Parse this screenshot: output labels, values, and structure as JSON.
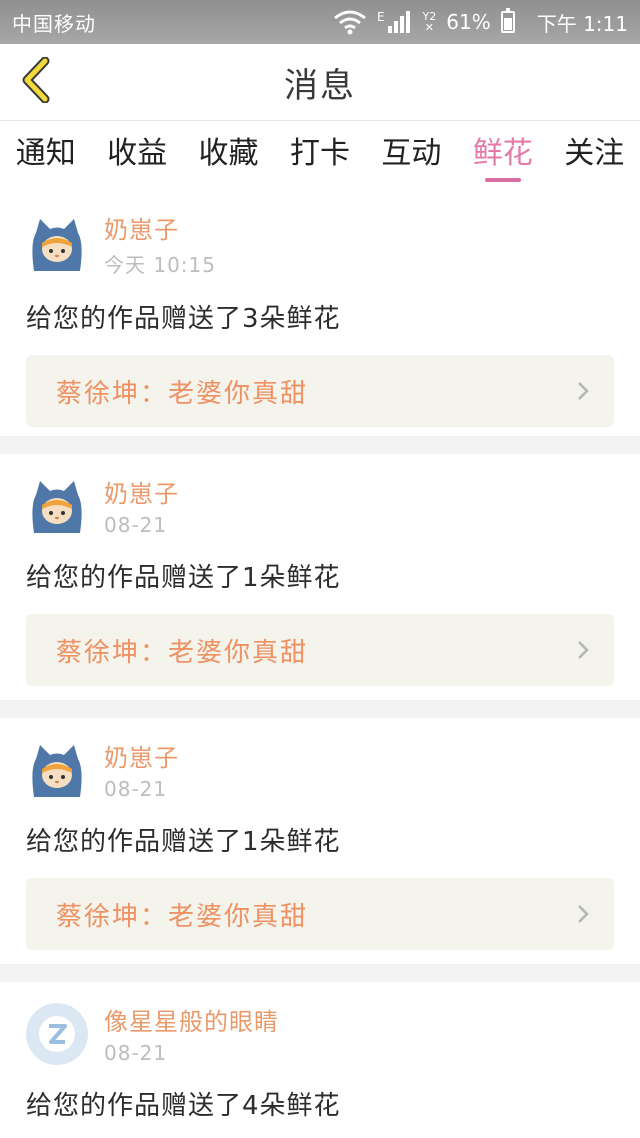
{
  "status_bar": {
    "carrier": "中国移动",
    "network": "E",
    "sim_label": "Y2",
    "battery_percent": "61%",
    "time": "下午 1:11"
  },
  "header": {
    "title": "消息",
    "back_icon": "chevron-left-icon"
  },
  "tabs": [
    {
      "label": "通知",
      "active": false
    },
    {
      "label": "收益",
      "active": false
    },
    {
      "label": "收藏",
      "active": false
    },
    {
      "label": "打卡",
      "active": false
    },
    {
      "label": "互动",
      "active": false
    },
    {
      "label": "鲜花",
      "active": true
    },
    {
      "label": "关注",
      "active": false
    }
  ],
  "messages": [
    {
      "user": "奶崽子",
      "time": "今天 10:15",
      "text": "给您的作品赠送了3朵鲜花",
      "quote": "蔡徐坤：老婆你真甜"
    },
    {
      "user": "奶崽子",
      "time": "08-21",
      "text": "给您的作品赠送了1朵鲜花",
      "quote": "蔡徐坤：老婆你真甜"
    },
    {
      "user": "奶崽子",
      "time": "08-21",
      "text": "给您的作品赠送了1朵鲜花",
      "quote": "蔡徐坤：老婆你真甜"
    },
    {
      "user": "像星星般的眼睛",
      "time": "08-21",
      "text": "给您的作品赠送了4朵鲜花"
    }
  ],
  "colors": {
    "accent_pink": "#e47aa8",
    "username_orange": "#e99a6a",
    "quote_orange": "#ee9163",
    "quote_bg": "#f4f3ec",
    "back_yellow": "#f3da3b"
  }
}
